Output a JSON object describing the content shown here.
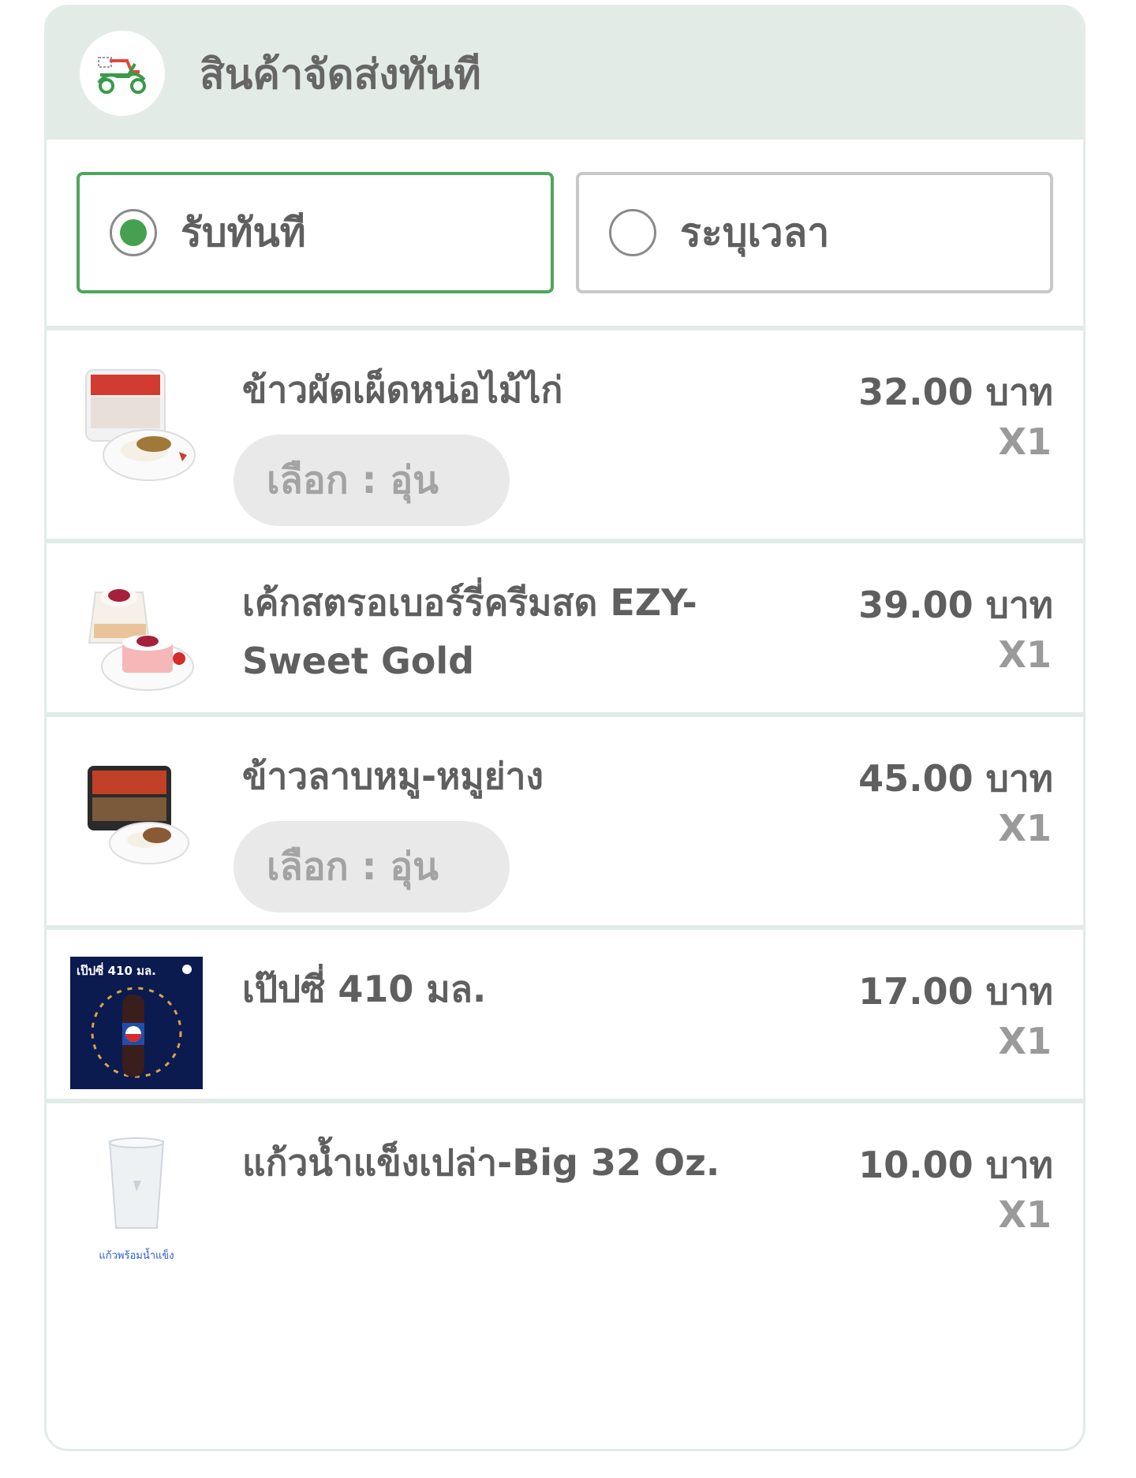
{
  "header": {
    "title": "สินค้าจัดส่งทันที",
    "icon": "scooter-icon",
    "accent": "#4ea65a"
  },
  "delivery_options": [
    {
      "label": "รับทันที",
      "selected": true
    },
    {
      "label": "ระบุเวลา",
      "selected": false
    }
  ],
  "items": [
    {
      "name": "ข้าวผัดเผ็ดหน่อไม้ไก่",
      "price": "32.00 บาท",
      "qty": "X1",
      "choice": "เลือก : อุ่น",
      "image": "rice-meal-image"
    },
    {
      "name": "เค้กสตรอเบอร์รี่ครีมสด EZY-Sweet Gold",
      "price": "39.00 บาท",
      "qty": "X1",
      "image": "strawberry-cake-image"
    },
    {
      "name": "ข้าวลาบหมู-หมูย่าง",
      "price": "45.00 บาท",
      "qty": "X1",
      "choice": "เลือก : อุ่น",
      "image": "larb-rice-image"
    },
    {
      "name": "เป๊ปซี่ 410 มล.",
      "price": "17.00 บาท",
      "qty": "X1",
      "image": "pepsi-image",
      "image_text": "เป๊ปซี่ 410 มล."
    },
    {
      "name": "แก้วน้ำแข็งเปล่า-Big 32 Oz.",
      "price": "10.00 บาท",
      "qty": "X1",
      "image": "ice-cup-image",
      "image_caption": "แก้วพร้อมน้ำแข็ง"
    }
  ]
}
